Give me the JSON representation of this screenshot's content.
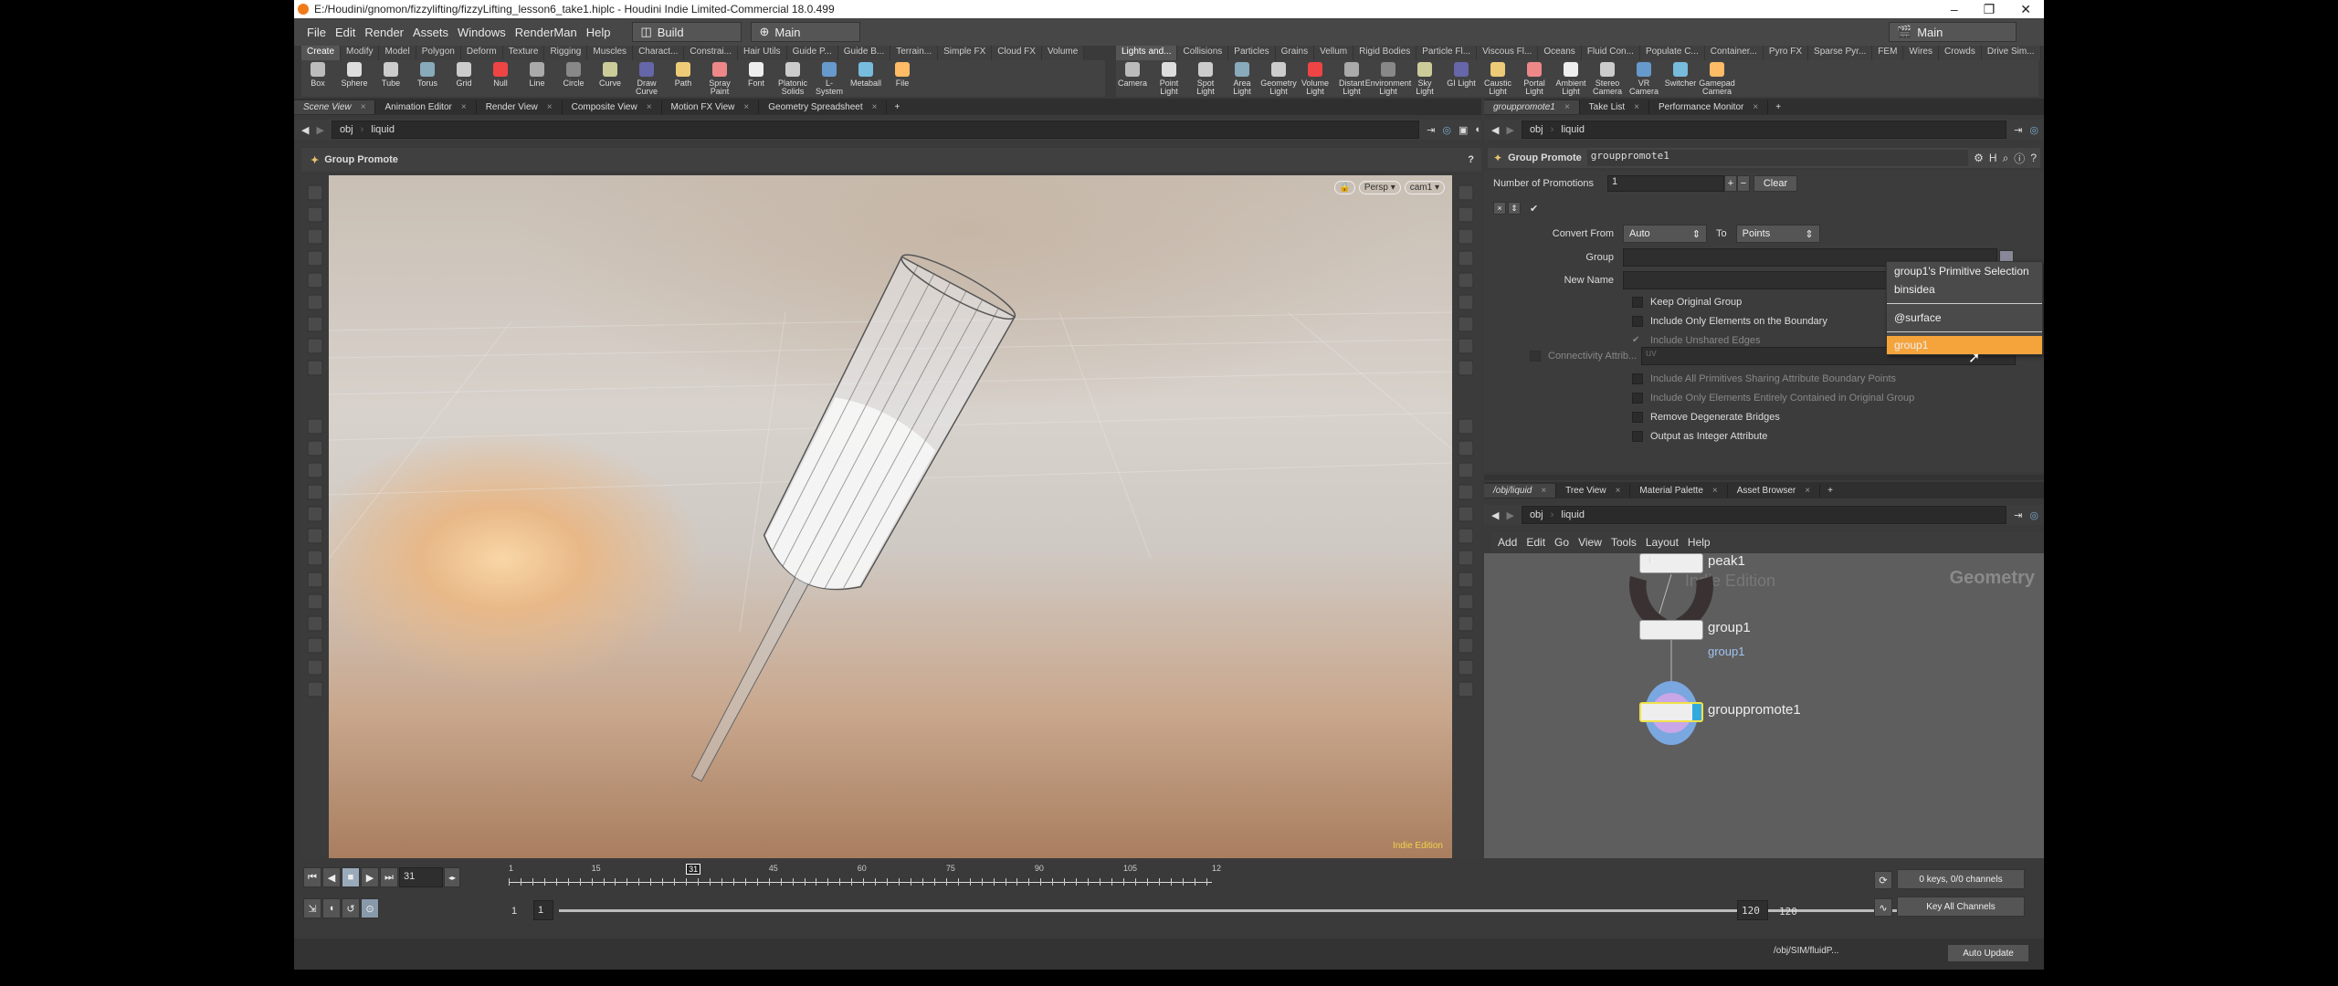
{
  "window": {
    "title": "E:/Houdini/gnomon/fizzylifting/fizzyLifting_lesson6_take1.hiplc - Houdini Indie Limited-Commercial 18.0.499",
    "controls": [
      "–",
      "❐",
      "✕"
    ]
  },
  "menubar": {
    "items": [
      "File",
      "Edit",
      "Render",
      "Assets",
      "Windows",
      "RenderMan",
      "Help"
    ],
    "desktop": "Build",
    "main": "Main",
    "right_desktop": "Main"
  },
  "shelf_left": {
    "tabs": [
      "Create",
      "Modify",
      "Model",
      "Polygon",
      "Deform",
      "Texture",
      "Rigging",
      "Muscles",
      "Charact...",
      "Constrai...",
      "Hair Utils",
      "Guide P...",
      "Guide B...",
      "Terrain...",
      "Simple FX",
      "Cloud FX",
      "Volume"
    ],
    "tools": [
      "Box",
      "Sphere",
      "Tube",
      "Torus",
      "Grid",
      "Null",
      "Line",
      "Circle",
      "Curve",
      "Draw Curve",
      "Path",
      "Spray Paint",
      "Font",
      "Platonic Solids",
      "L-System",
      "Metaball",
      "File"
    ]
  },
  "shelf_right": {
    "tabs": [
      "Lights and...",
      "Collisions",
      "Particles",
      "Grains",
      "Vellum",
      "Rigid Bodies",
      "Particle Fl...",
      "Viscous Fl...",
      "Oceans",
      "Fluid Con...",
      "Populate C...",
      "Container...",
      "Pyro FX",
      "Sparse Pyr...",
      "FEM",
      "Wires",
      "Crowds",
      "Drive Sim..."
    ],
    "tools": [
      "Camera",
      "Point Light",
      "Spot Light",
      "Area Light",
      "Geometry Light",
      "Volume Light",
      "Distant Light",
      "Environment Light",
      "Sky Light",
      "GI Light",
      "Caustic Light",
      "Portal Light",
      "Ambient Light",
      "Stereo Camera",
      "VR Camera",
      "Switcher",
      "Gamepad Camera"
    ]
  },
  "left_pane": {
    "tabs": [
      "Scene View",
      "Animation Editor",
      "Render View",
      "Composite View",
      "Motion FX View",
      "Geometry Spreadsheet"
    ],
    "path": [
      "obj",
      "liquid"
    ],
    "operation": "Group Promote",
    "persp": "Persp ▾",
    "cam": "cam1 ▾",
    "edition": "Indie Edition"
  },
  "param_pane": {
    "tabs": [
      "grouppromote1",
      "Take List",
      "Performance Monitor"
    ],
    "path": [
      "obj",
      "liquid"
    ],
    "node_type": "Group Promote",
    "node_name": "grouppromote1",
    "num_promotions_label": "Number of Promotions",
    "num_promotions": "1",
    "clear": "Clear",
    "convert_from_label": "Convert From",
    "convert_from": "Auto",
    "to_label": "To",
    "to": "Points",
    "group_label": "Group",
    "group_value": "",
    "new_name_label": "New Name",
    "checkboxes": [
      {
        "label": "Keep Original Group",
        "checked": false,
        "enabled": true
      },
      {
        "label": "Include Only Elements on the Boundary",
        "checked": false,
        "enabled": true
      },
      {
        "label": "Include Unshared Edges",
        "checked": true,
        "enabled": false
      }
    ],
    "connectivity_label": "Connectivity Attrib...",
    "connectivity_value": "uv",
    "checkboxes2": [
      {
        "label": "Include All Primitives Sharing Attribute Boundary Points",
        "checked": false,
        "enabled": false
      },
      {
        "label": "Include Only Elements Entirely Contained in Original Group",
        "checked": false,
        "enabled": false
      },
      {
        "label": "Remove Degenerate Bridges",
        "checked": false,
        "enabled": true
      },
      {
        "label": "Output as Integer Attribute",
        "checked": false,
        "enabled": true
      }
    ],
    "dropdown": {
      "items": [
        "group1's Primitive Selection",
        "binsidea",
        "@surface",
        "group1"
      ],
      "highlighted": "group1",
      "highlight_color": "#f5a43c"
    }
  },
  "network_pane": {
    "tabs": [
      "/obj/liquid",
      "Tree View",
      "Material Palette",
      "Asset Browser"
    ],
    "path": [
      "obj",
      "liquid"
    ],
    "menu": [
      "Add",
      "Edit",
      "Go",
      "View",
      "Tools",
      "Layout",
      "Help"
    ],
    "context_label": "Geometry",
    "watermark": "Indie Edition",
    "nodes": [
      {
        "name": "peak1"
      },
      {
        "name": "group1",
        "sublabel": "group1"
      },
      {
        "name": "grouppromote1",
        "selected": true
      }
    ]
  },
  "timeline": {
    "current_frame": "31",
    "ticks": [
      "1",
      "15",
      "31",
      "45",
      "60",
      "75",
      "90",
      "105",
      "12"
    ],
    "start": "1",
    "range_start": "1",
    "range_end": "120",
    "end": "120",
    "keys": "0 keys, 0/0 channels",
    "key_all": "Key All Channels",
    "status_path": "/obj/SIM/fluidP...",
    "update": "Auto Update"
  }
}
